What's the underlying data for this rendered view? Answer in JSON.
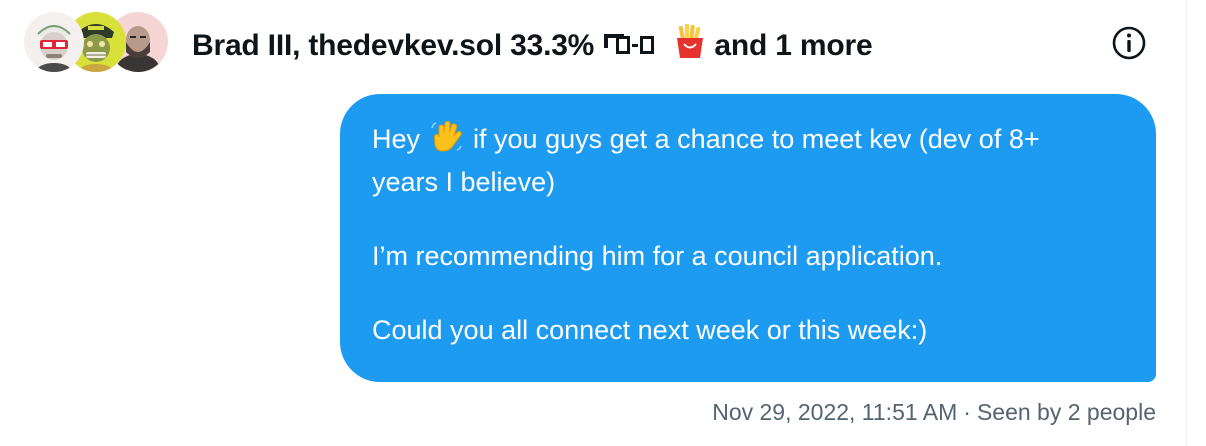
{
  "conversation": {
    "title_names": "Brad III, thedevkev.sol 33.3% ",
    "title_more": " and 1 more",
    "title_glyph_icon": "sunglasses-kaomoji-icon",
    "title_emoji_icon": "french-fries-icon",
    "info_icon": "info-icon"
  },
  "avatars": [
    {
      "name": "avatar-white-hat-character",
      "bg": "#f3f0ee"
    },
    {
      "name": "avatar-ape-character",
      "bg": "#d8e03a"
    },
    {
      "name": "avatar-bearded-man",
      "bg": "#f6d6d4"
    }
  ],
  "message": {
    "line1_before_emoji": "Hey ",
    "line1_emoji_icon": "waving-hand-icon",
    "line1_after_emoji": " if you guys get a chance to meet kev (dev of 8+",
    "line2": "years I believe)",
    "para2": "I’m recommending him for a council application.",
    "para3": "Could you all connect next week or this week:)"
  },
  "meta": {
    "timestamp": "Nov 29, 2022, 11:51 AM",
    "separator": "·",
    "seen": "Seen by 2 people"
  },
  "colors": {
    "bubble": "#1d9bf0",
    "meta_text": "#536471",
    "title_text": "#0f1419"
  }
}
